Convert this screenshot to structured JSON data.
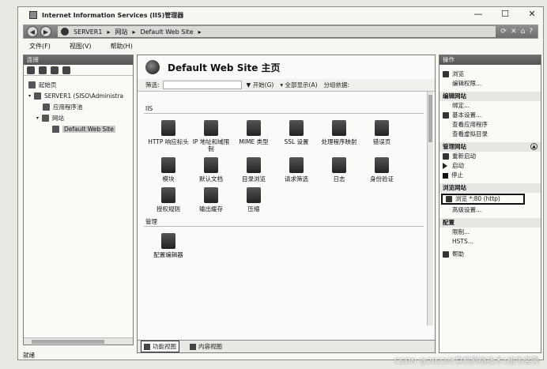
{
  "window": {
    "title": "Internet Information Services (IIS)管理器"
  },
  "address": {
    "segments": [
      "SERVER1",
      "网站",
      "Default Web Site"
    ]
  },
  "menu": [
    "文件(F)",
    "视图(V)",
    "帮助(H)"
  ],
  "connections": {
    "header": "连接",
    "tree": [
      {
        "label": "起始页",
        "indent": 0
      },
      {
        "label": "SERVER1 (SISO\\Administra",
        "indent": 1
      },
      {
        "label": "应用程序池",
        "indent": 2
      },
      {
        "label": "网站",
        "indent": 2
      },
      {
        "label": "Default Web Site",
        "indent": 3,
        "selected": true
      }
    ]
  },
  "center": {
    "title": "Default Web Site 主页",
    "filter": {
      "label": "筛选:",
      "start": "开始(G)",
      "showAll": "全部显示(A)",
      "group": "分组依据:"
    },
    "sections": [
      {
        "label": "IIS",
        "features": [
          "HTTP 响应标头",
          "IP 地址和域限制",
          "MIME 类型",
          "SSL 设置",
          "处理程序映射",
          "错误页",
          "模块",
          "默认文档",
          "目录浏览",
          "请求筛选",
          "日志",
          "身份验证",
          "授权规则",
          "输出缓存",
          "压缩"
        ]
      },
      {
        "label": "管理",
        "features": [
          "配置编辑器"
        ]
      }
    ],
    "tabs": [
      "功能视图",
      "内容视图"
    ]
  },
  "actions": {
    "header": "操作",
    "groups": [
      {
        "title": "",
        "items": [
          {
            "label": "浏览",
            "icon": "browse"
          },
          {
            "label": "编辑权限...",
            "icon": ""
          }
        ]
      },
      {
        "title": "编辑网站",
        "items": [
          {
            "label": "绑定...",
            "icon": ""
          },
          {
            "label": "基本设置...",
            "icon": "settings"
          },
          {
            "label": "查看应用程序",
            "icon": ""
          },
          {
            "label": "查看虚拟目录",
            "icon": ""
          }
        ]
      },
      {
        "title": "管理网站",
        "collapsible": true,
        "items": [
          {
            "label": "重新启动",
            "icon": "restart"
          },
          {
            "label": "启动",
            "icon": "play"
          },
          {
            "label": "停止",
            "icon": "stop"
          }
        ]
      },
      {
        "title": "浏览网站",
        "items": [
          {
            "label": "浏览 *:80 (http)",
            "icon": "browse",
            "boxed": true
          },
          {
            "label": "高级设置...",
            "icon": ""
          }
        ]
      },
      {
        "title": "配置",
        "items": [
          {
            "label": "限制...",
            "icon": ""
          },
          {
            "label": "HSTS...",
            "icon": ""
          }
        ]
      },
      {
        "title": "",
        "items": [
          {
            "label": "帮助",
            "icon": "help"
          }
        ]
      }
    ]
  },
  "status": {
    "text": "就绪"
  },
  "watermark": "CSDN @2023计算机网络技术1班韦茗馨"
}
